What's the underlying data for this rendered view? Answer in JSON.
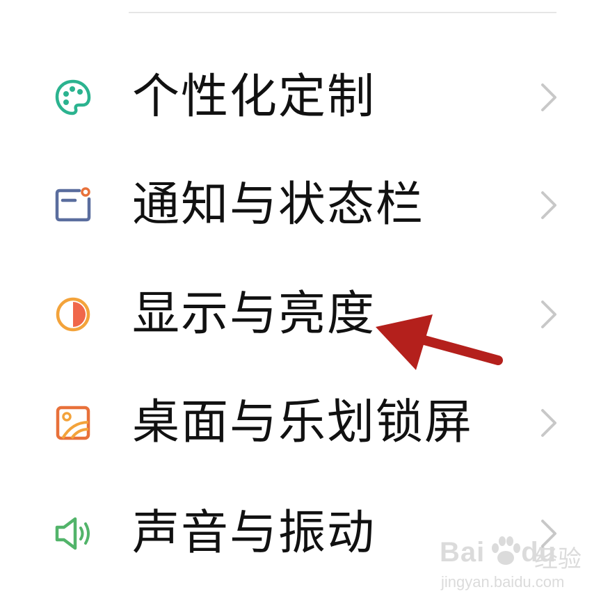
{
  "settings": {
    "items": [
      {
        "label": "个性化定制",
        "icon": "palette-icon",
        "color": "#2bb38f"
      },
      {
        "label": "通知与状态栏",
        "icon": "notification-icon",
        "color": "#5a6d9e"
      },
      {
        "label": "显示与亮度",
        "icon": "brightness-icon",
        "color": "#f3a33b"
      },
      {
        "label": "桌面与乐划锁屏",
        "icon": "wallpaper-icon",
        "color": "#e8713a"
      },
      {
        "label": "声音与振动",
        "icon": "speaker-icon",
        "color": "#52b46a"
      }
    ]
  },
  "annotation": {
    "arrow_color": "#b4201c",
    "points_to": "显示与亮度"
  },
  "watermark": {
    "brand": "Bai",
    "brand_suffix": "du",
    "cn": "经验",
    "url": "jingyan.baidu.com"
  }
}
